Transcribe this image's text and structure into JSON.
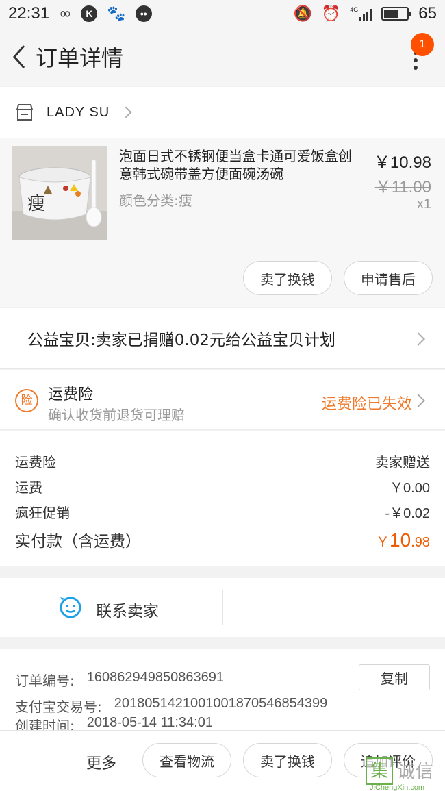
{
  "status_bar": {
    "time": "22:31",
    "battery": "65",
    "battery_level": 0.65,
    "network": "4G"
  },
  "nav": {
    "title": "订单详情",
    "badge_count": "1"
  },
  "shop": {
    "name": "LADY SU"
  },
  "item": {
    "title": "泡面日式不锈钢便当盒卡通可爱饭盒创意韩式碗带盖方便面碗汤碗",
    "sku": "颜色分类:瘦",
    "thumb_char": "瘦",
    "price": "￥10.98",
    "original_price": "￥11.00",
    "quantity": "x1",
    "buttons": {
      "sell": "卖了换钱",
      "after_sale": "申请售后"
    }
  },
  "charity": {
    "text": "公益宝贝:卖家已捐赠0.02元给公益宝贝计划"
  },
  "insurance": {
    "icon_char": "险",
    "title": "运费险",
    "subtitle": "确认收货前退货可理赔",
    "status": "运费险已失效"
  },
  "fees": {
    "rows": [
      {
        "label": "运费险",
        "value": "卖家赠送"
      },
      {
        "label": "运费",
        "value": "￥0.00"
      },
      {
        "label": "疯狂促销",
        "value": "-￥0.02"
      }
    ],
    "total_label": "实付款（含运费）",
    "total_yen": "￥",
    "total_int": "10",
    "total_dec": ".98"
  },
  "contact": {
    "label": "联系卖家"
  },
  "order_info": {
    "order_no_label": "订单编号:",
    "order_no": "160862949850863691",
    "copy": "复制",
    "alipay_label": "支付宝交易号:",
    "alipay_no": "2018051421001001870546854399",
    "created_label": "创建时间:",
    "created": "2018-05-14 11:34:01"
  },
  "bottom_bar": {
    "more": "更多",
    "logistics": "查看物流",
    "sell": "卖了换钱",
    "review": "追加评价"
  },
  "watermark": {
    "char": "集",
    "text": "诚信",
    "sub": "JiChengXin.com"
  },
  "colors": {
    "accent": "#f05a00",
    "insurance": "#f07a2a",
    "badge": "#ff5000",
    "contact_icon": "#1aa0e8"
  }
}
